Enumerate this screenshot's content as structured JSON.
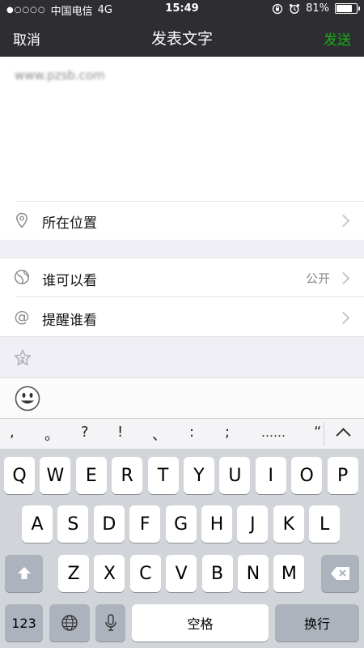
{
  "status_bar": {
    "signal_dots": "●○○○○",
    "carrier": "中国电信",
    "network": "4G",
    "time": "15:49",
    "battery_percent": "81%",
    "battery_level": 0.81
  },
  "nav": {
    "cancel": "取消",
    "title": "发表文字",
    "send": "发送",
    "send_color": "#1aad19"
  },
  "compose": {
    "text": "www.pzsb.com"
  },
  "options": {
    "location": {
      "label": "所在位置",
      "icon": "location-pin-icon"
    },
    "visibility": {
      "label": "谁可以看",
      "value": "公开",
      "icon": "globe-icon"
    },
    "mention": {
      "label": "提醒谁看",
      "icon": "at-icon"
    }
  },
  "punctuation": [
    ",",
    "。",
    "?",
    "!",
    "、",
    ":",
    ";",
    "……",
    "“"
  ],
  "keyboard": {
    "row1": [
      "Q",
      "W",
      "E",
      "R",
      "T",
      "Y",
      "U",
      "I",
      "O",
      "P"
    ],
    "row2": [
      "A",
      "S",
      "D",
      "F",
      "G",
      "H",
      "J",
      "K",
      "L"
    ],
    "row3": [
      "Z",
      "X",
      "C",
      "V",
      "B",
      "N",
      "M"
    ],
    "numbers": "123",
    "space": "空格",
    "return": "换行"
  }
}
